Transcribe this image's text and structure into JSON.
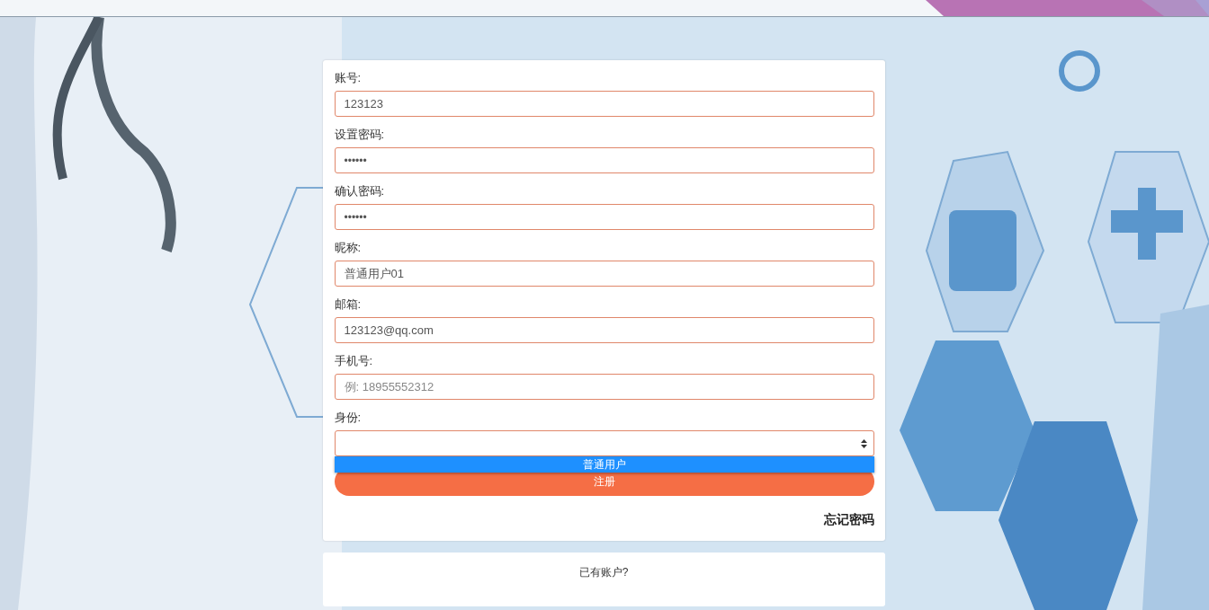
{
  "fields": [
    {
      "kind": "text",
      "label": "账号:",
      "value": "123123"
    },
    {
      "kind": "password",
      "label": "设置密码:",
      "value": "••••••"
    },
    {
      "kind": "password",
      "label": "确认密码:",
      "value": "••••••"
    },
    {
      "kind": "text",
      "label": "昵称:",
      "value": "普通用户01"
    },
    {
      "kind": "text",
      "label": "邮箱:",
      "value": "123123@qq.com"
    },
    {
      "kind": "text",
      "label": "手机号:",
      "placeholder": "例: 18955552312"
    },
    {
      "kind": "select",
      "label": "身份:",
      "expanded": true,
      "options": [
        {
          "label": "普通用户",
          "selected": true
        }
      ]
    }
  ],
  "submit": "注册",
  "forgot_link": "忘记密码",
  "footer_text": "已有账户?"
}
